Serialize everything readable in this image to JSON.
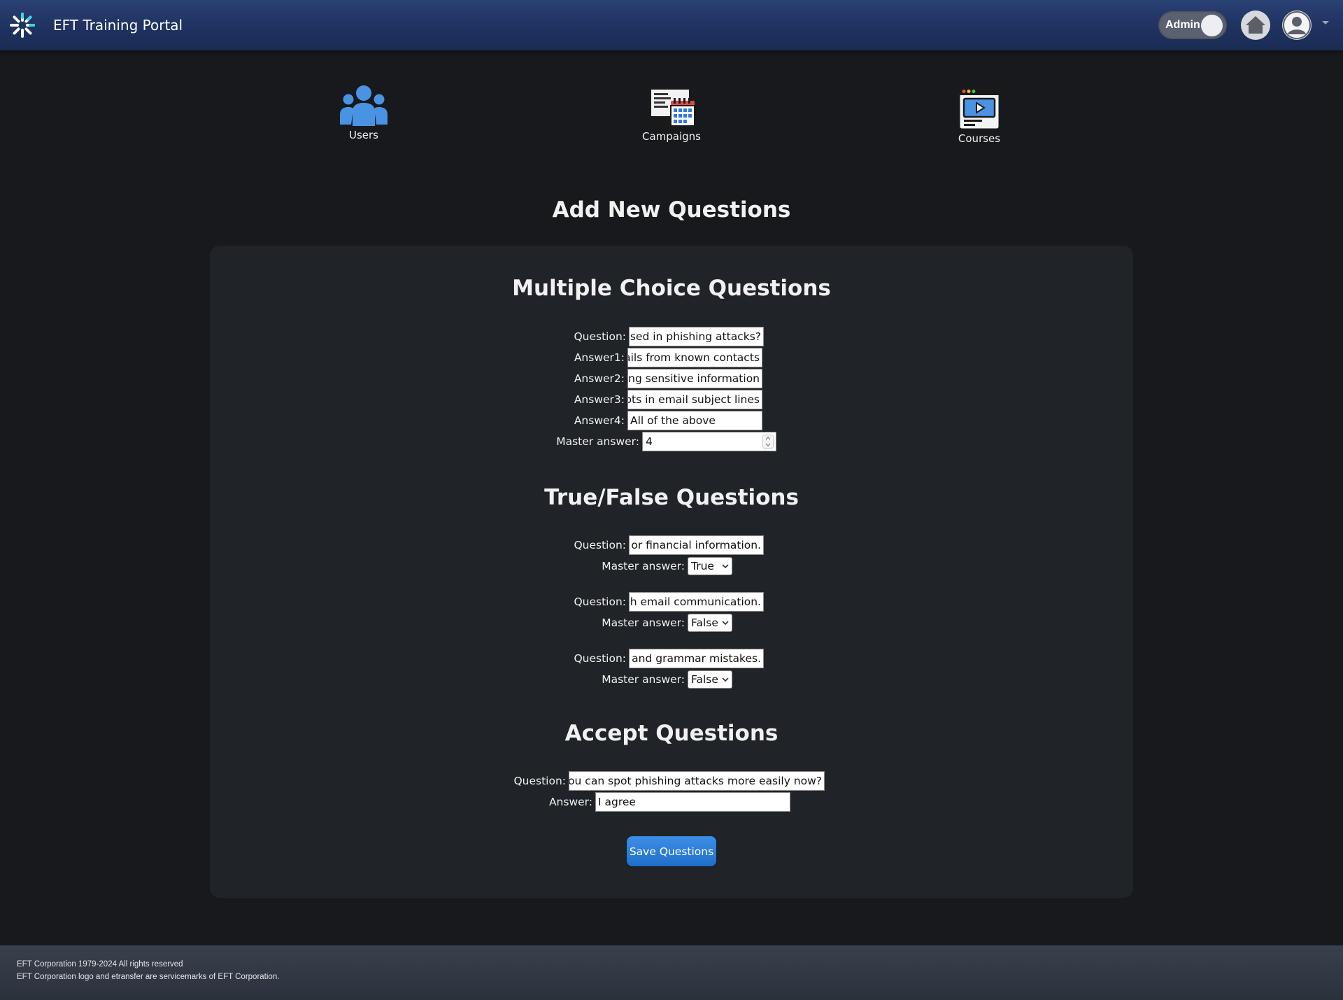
{
  "header": {
    "brand": "EFT Training Portal",
    "admin_toggle_label": "Admin",
    "icons": [
      "eft-spark-logo-icon",
      "home-icon",
      "user-avatar-icon",
      "caret-down-icon"
    ]
  },
  "nav": {
    "users_label": "Users",
    "campaigns_label": "Campaigns",
    "courses_label": "Courses",
    "icons": [
      "users-group-icon",
      "campaigns-calendar-monitor-icon",
      "courses-video-player-icon"
    ]
  },
  "page_title": "Add New Questions",
  "mc": {
    "title": "Multiple Choice Questions",
    "question_label": "Question:",
    "question_value": "e used in phishing attacks?",
    "answer1_label": "Answer1:",
    "answer1_value": "mails from known contacts",
    "answer2_label": "Answer2:",
    "answer2_value": "osing sensitive information",
    "answer3_label": "Answer3:",
    "answer3_value": "mpts in email subject lines",
    "answer4_label": "Answer4:",
    "answer4_value": "All of the above",
    "master_label": "Master answer:",
    "master_value": "4"
  },
  "tf": {
    "title": "True/False Questions",
    "question_label": "Question:",
    "master_label": "Master answer:",
    "items": [
      {
        "question": "al or financial information.",
        "master": "True"
      },
      {
        "question": "ugh email communication.",
        "master": "False"
      },
      {
        "question": "ng and grammar mistakes.",
        "master": "False"
      }
    ]
  },
  "accept": {
    "title": "Accept Questions",
    "question_label": "Question:",
    "question_value": "ink you can spot phishing attacks more easily now?",
    "answer_label": "Answer:",
    "answer_value": "I agree"
  },
  "save_button_label": "Save Questions",
  "footer": {
    "line1": "EFT Corporation 1979-2024 All rights reserved",
    "line2": "EFT Corporation logo and etransfer are servicemarks of EFT Corporation."
  },
  "colors": {
    "header_bg": "#1f3260",
    "page_bg": "#17191c",
    "panel_bg": "#202327",
    "accent_blue": "#2f82dc",
    "footer_bg": "#333a45"
  }
}
